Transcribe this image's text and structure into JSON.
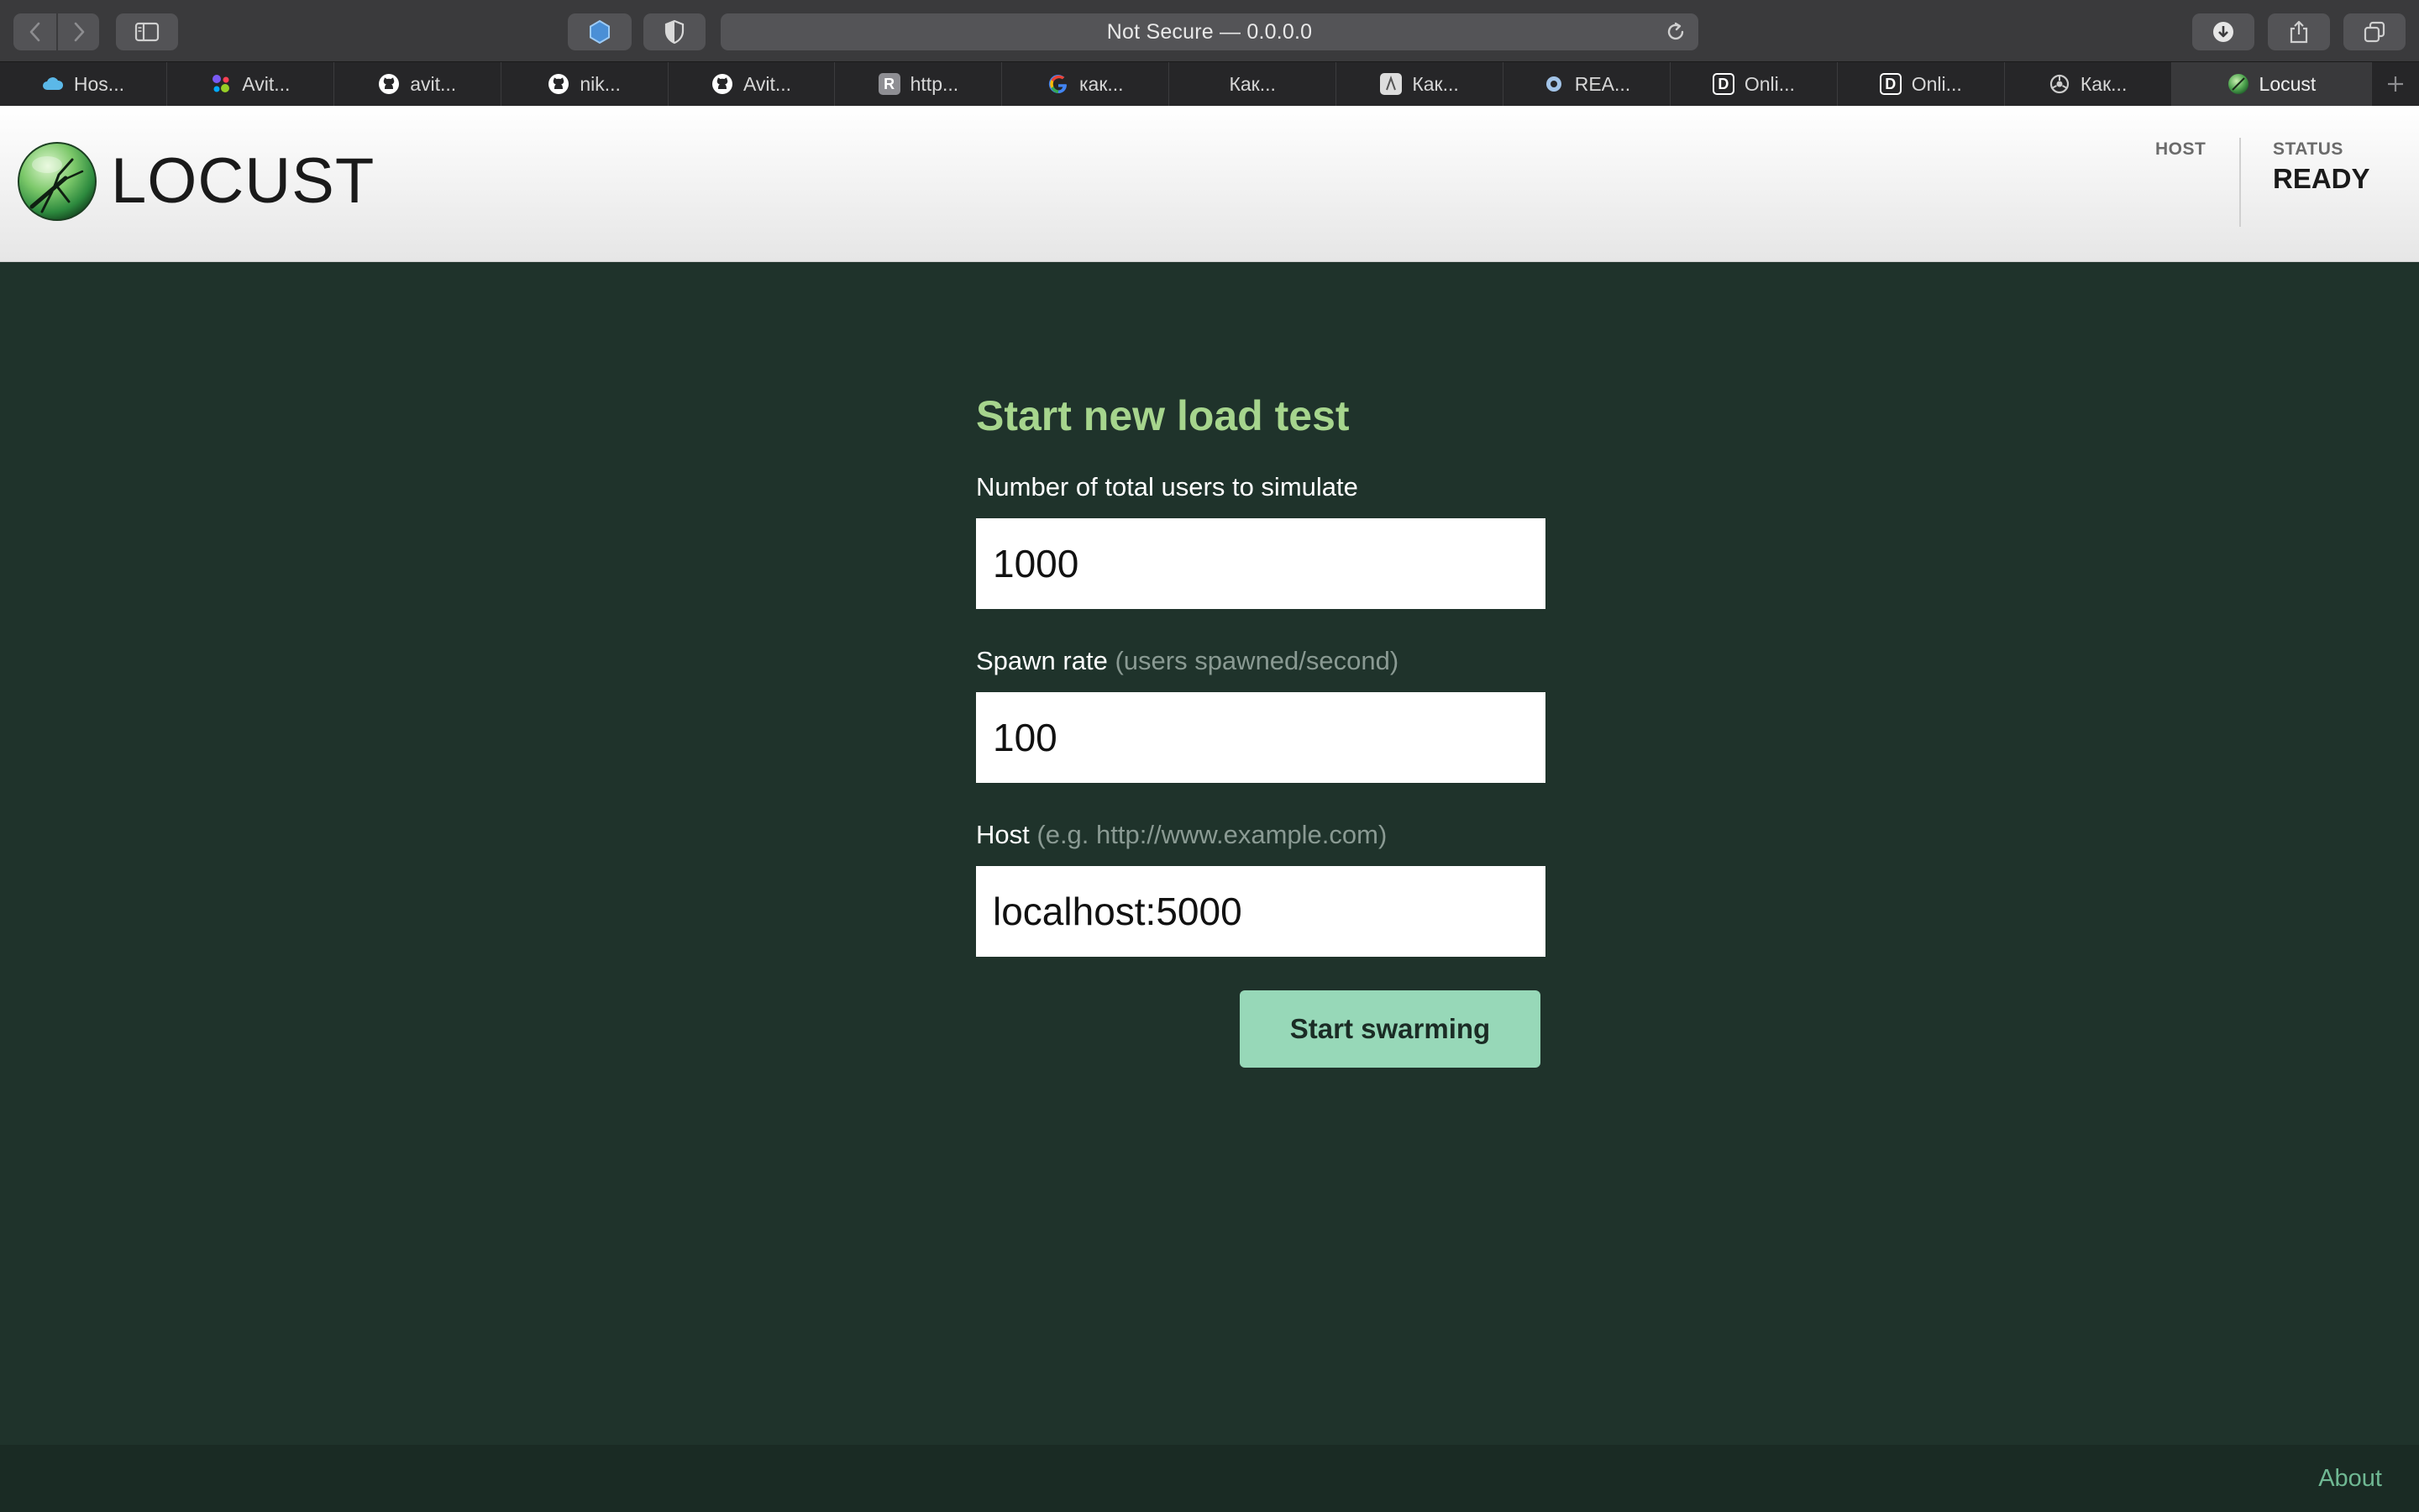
{
  "browser": {
    "url_text": "Not Secure — 0.0.0.0",
    "tabs": [
      {
        "label": "Hos...",
        "icon": "cloud-icon",
        "color": "#5bb8e8"
      },
      {
        "label": "Avit...",
        "icon": "avito-dots-icon",
        "color": "#7a5af5"
      },
      {
        "label": "avit...",
        "icon": "github-icon",
        "color": "#ffffff"
      },
      {
        "label": "nik...",
        "icon": "github-icon",
        "color": "#ffffff"
      },
      {
        "label": "Avit...",
        "icon": "github-icon",
        "color": "#ffffff"
      },
      {
        "label": "http...",
        "icon": "r-letter-icon",
        "color": "#8e8e93",
        "letter": "R"
      },
      {
        "label": "как...",
        "icon": "google-icon",
        "color": "#4285f4"
      },
      {
        "label": "Как...",
        "icon": "",
        "color": ""
      },
      {
        "label": "Как...",
        "icon": "page-icon",
        "color": "#dddddd"
      },
      {
        "label": "REA...",
        "icon": "react-icon",
        "color": "#a3c4e8"
      },
      {
        "label": "Onli...",
        "icon": "d-letter-icon",
        "color": "#ffffff",
        "letter": "D"
      },
      {
        "label": "Onli...",
        "icon": "d-letter-icon",
        "color": "#ffffff",
        "letter": "D"
      },
      {
        "label": "Как...",
        "icon": "settings-wheel-icon",
        "color": "#cccccc"
      },
      {
        "label": "Locust",
        "icon": "locust-favicon-icon",
        "color": "#5fae5f",
        "active": true
      }
    ]
  },
  "header": {
    "logo_text": "LOCUST",
    "host_label": "HOST",
    "host_value": "",
    "status_label": "STATUS",
    "status_value": "READY"
  },
  "form": {
    "title": "Start new load test",
    "users_label": "Number of total users to simulate",
    "users_value": "1000",
    "spawn_label": "Spawn rate",
    "spawn_hint": "(users spawned/second)",
    "spawn_value": "100",
    "host_label": "Host",
    "host_hint": "(e.g. http://www.example.com)",
    "host_value": "localhost:5000",
    "submit_label": "Start swarming"
  },
  "footer": {
    "about_label": "About"
  },
  "colors": {
    "page_bg": "#1f332b",
    "title_green": "#a6d58d",
    "button_green": "#97d8b8",
    "footer_link": "#6fb893"
  }
}
